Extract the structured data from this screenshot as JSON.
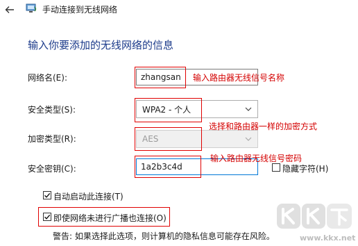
{
  "window": {
    "title": "手动连接到无线网络"
  },
  "heading": "输入你要添加的无线网络的信息",
  "form": {
    "network_name_label": "网络名(E):",
    "network_name_value": "zhangsan",
    "security_type_label": "安全类型(S):",
    "security_type_value": "WPA2 - 个人",
    "encryption_type_label": "加密类型(R):",
    "encryption_type_value": "AES",
    "security_key_label": "安全密钥(C):",
    "security_key_value": "1a2b3c4d",
    "hide_chars_label": "隐藏字符(H)",
    "hide_chars_checked": false,
    "auto_connect_label": "自动启动此连接(T)",
    "auto_connect_checked": true,
    "connect_hidden_label": "即使网络未进行广播也连接(O)",
    "connect_hidden_checked": true,
    "warning": "警告: 如果选择此选项，则计算机的隐私信息可能存在风险。"
  },
  "annotations": {
    "name_hint": "输入路由器无线信号名称",
    "security_hint": "选择和路由器一样的加密方式",
    "key_hint": "输入路由器无线信号密码"
  },
  "watermark": {
    "logo_text": "KK下载",
    "url": "www.kkx.net"
  },
  "colors": {
    "heading": "#1b3a8a",
    "annotation": "#d40000",
    "focus_border": "#0078d7"
  },
  "icons": [
    "back-arrow-icon",
    "network-icon",
    "chevron-down-icon",
    "checkmark-icon"
  ]
}
